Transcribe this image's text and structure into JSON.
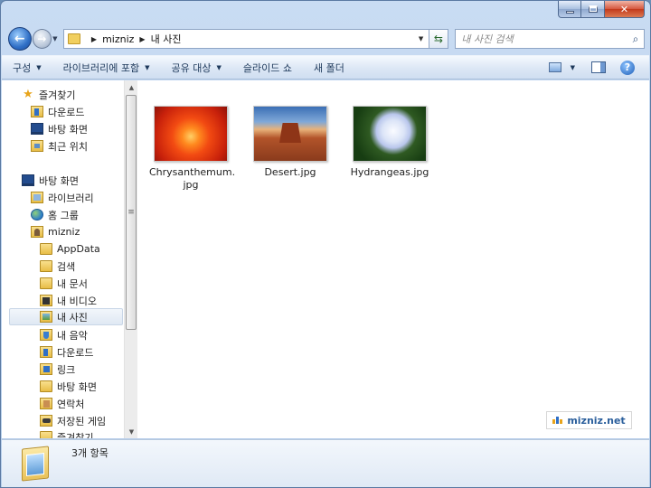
{
  "address": {
    "crumbs": [
      "mizniz",
      "내 사진"
    ],
    "search_placeholder": "내 사진 검색"
  },
  "toolbar": {
    "organize": "구성",
    "include_library": "라이브러리에 포함",
    "share": "공유 대상",
    "slideshow": "슬라이드 쇼",
    "new_folder": "새 폴더"
  },
  "nav": {
    "favorites": "즐겨찾기",
    "fav_downloads": "다운로드",
    "fav_desktop": "바탕 화면",
    "fav_recent": "최근 위치",
    "desktop": "바탕 화면",
    "libraries": "라이브러리",
    "homegroup": "홈 그룹",
    "user": "mizniz",
    "appdata": "AppData",
    "searches": "검색",
    "documents": "내 문서",
    "videos": "내 비디오",
    "pictures": "내 사진",
    "music": "내 음악",
    "downloads": "다운로드",
    "links": "링크",
    "user_desktop": "바탕 화면",
    "contacts": "연락처",
    "saved_games": "저장된 게임",
    "user_favorites": "즐겨찾기"
  },
  "files": [
    {
      "name_line1": "Chrysanthemum.",
      "name_line2": "jpg"
    },
    {
      "name_line1": "Desert.jpg"
    },
    {
      "name_line1": "Hydrangeas.jpg"
    }
  ],
  "watermark": "mizniz.net",
  "status": {
    "item_count": "3개 항목"
  }
}
